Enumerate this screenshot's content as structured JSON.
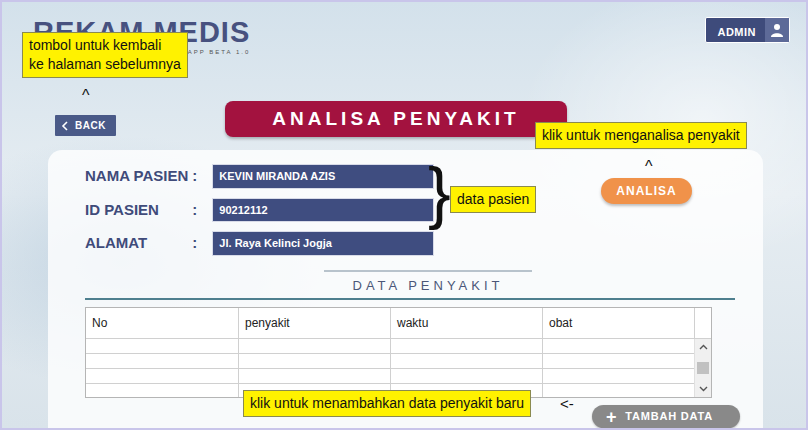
{
  "app": {
    "title": "REKAM MEDIS",
    "version": "APP BETA 1.0"
  },
  "user_menu": {
    "label": "ADMIN"
  },
  "back_button": {
    "label": "BACK"
  },
  "page_title": "ANALISA PENYAKIT",
  "analyze_button": {
    "label": "ANALISA"
  },
  "patient": [
    {
      "label": "NAMA PASIEN",
      "separator": ":",
      "value": "KEVIN MIRANDA AZIS"
    },
    {
      "label": "ID PASIEN",
      "separator": ":",
      "value": "90212112"
    },
    {
      "label": "ALAMAT",
      "separator": ":",
      "value": "Jl. Raya Kelinci Jogja"
    }
  ],
  "section_title": "DATA PENYAKIT",
  "table": {
    "columns": [
      "No",
      "penyakit",
      "waktu",
      "obat"
    ],
    "rows": [
      [
        "",
        "",
        "",
        ""
      ],
      [
        "",
        "",
        "",
        ""
      ],
      [
        "",
        "",
        "",
        ""
      ],
      [
        "",
        "",
        "",
        ""
      ]
    ],
    "scroll_position": 0.5
  },
  "add_button": {
    "icon": "+",
    "label": "TAMBAH DATA"
  },
  "annotations": {
    "back": {
      "lines": [
        "tombol untuk kembali",
        "ke halaman sebelumnya"
      ],
      "pointer": "^"
    },
    "analyze": {
      "lines": [
        "klik untuk menganalisa penyakit"
      ],
      "pointer": "^"
    },
    "patient": {
      "lines": [
        "data pasien"
      ],
      "pointer": "}"
    },
    "add": {
      "lines": [
        "klik untuk menambahkan data penyakit baru"
      ],
      "pointer": "<-"
    }
  }
}
